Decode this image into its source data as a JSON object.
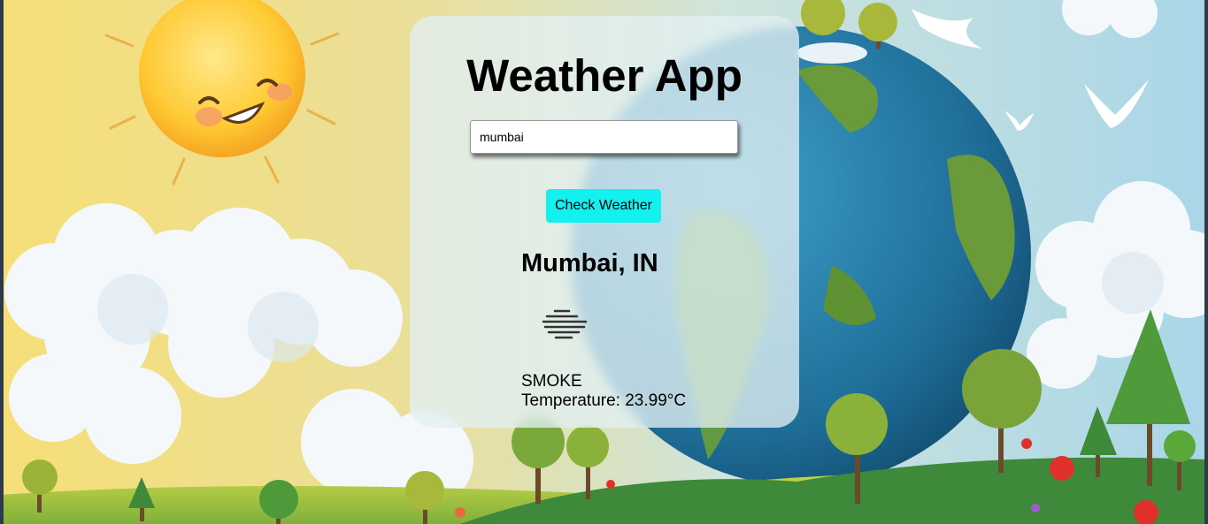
{
  "app": {
    "title": "Weather App"
  },
  "search": {
    "value": "mumbai"
  },
  "actions": {
    "check_label": "Check Weather"
  },
  "result": {
    "city": "Mumbai, IN",
    "condition": "SMOKE",
    "temperature_label": "Temperature: 23.99°C",
    "icon": "smoke-haze-icon"
  },
  "colors": {
    "button_bg": "#12f0ef",
    "card_bg": "#e2f0f2"
  }
}
